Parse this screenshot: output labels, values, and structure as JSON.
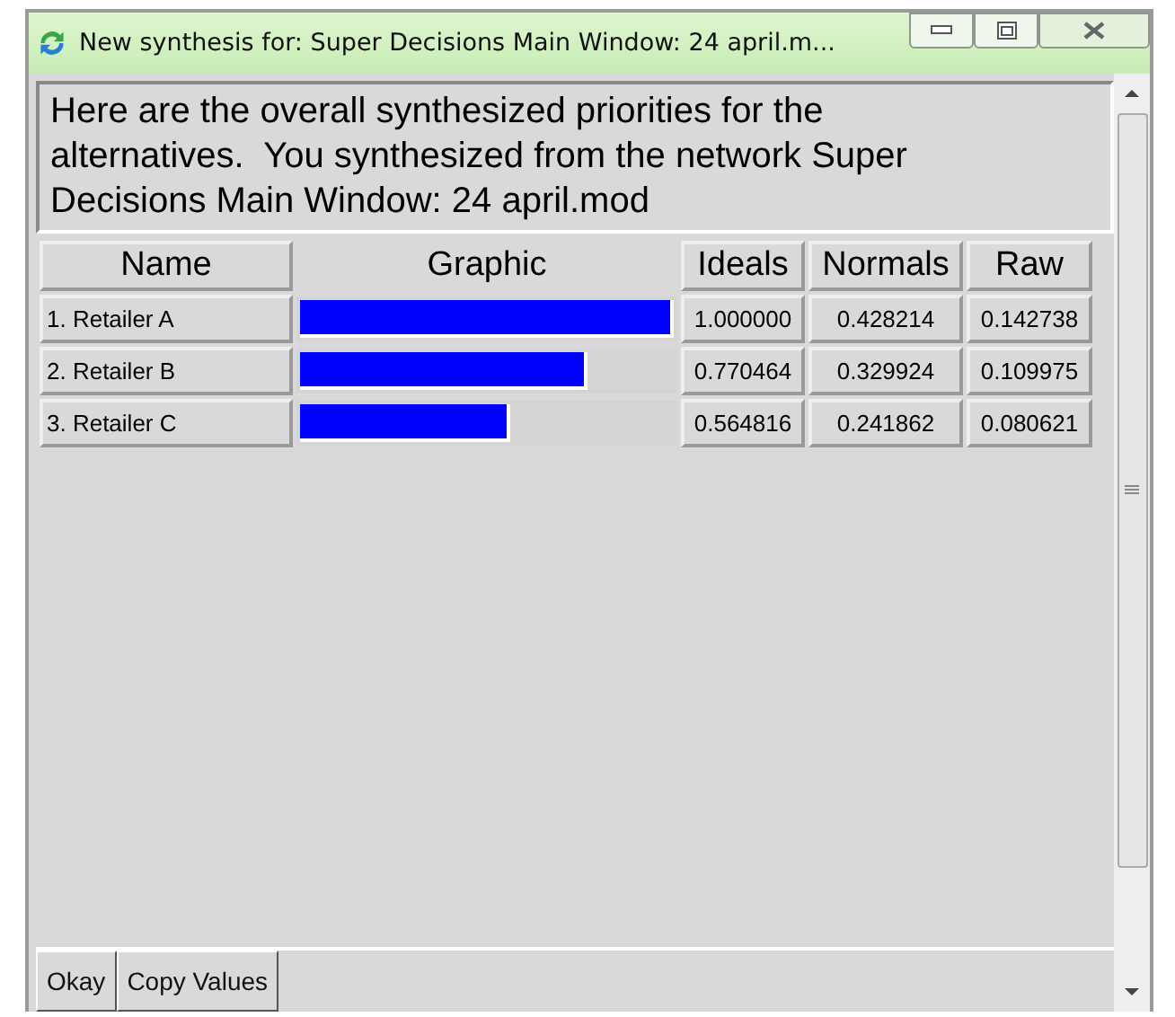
{
  "window": {
    "title": "New synthesis for: Super Decisions Main Window: 24 april.m..."
  },
  "message": "Here are the overall synthesized priorities for the\nalternatives.  You synthesized from the network Super\nDecisions Main Window: 24 april.mod",
  "table": {
    "columns": [
      "Name",
      "Graphic",
      "Ideals",
      "Normals",
      "Raw"
    ],
    "rows": [
      {
        "name": "1. Retailer A",
        "level": 1.0,
        "ideals": "1.000000",
        "normals": "0.428214",
        "raw": "0.142738"
      },
      {
        "name": "2. Retailer B",
        "level": 0.770464,
        "ideals": "0.770464",
        "normals": "0.329924",
        "raw": "0.109975"
      },
      {
        "name": "3. Retailer C",
        "level": 0.564816,
        "ideals": "0.564816",
        "normals": "0.241862",
        "raw": "0.080621"
      }
    ]
  },
  "buttons": [
    "Okay",
    "Copy Values"
  ]
}
